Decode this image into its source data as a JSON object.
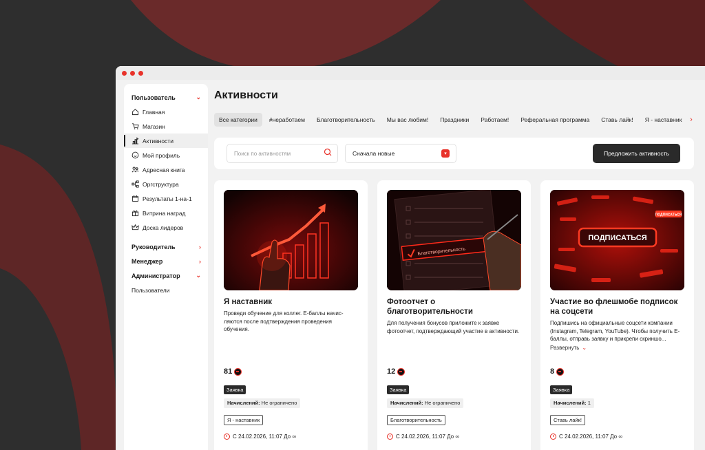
{
  "colors": {
    "accent": "#e8322a",
    "dark": "#2a2a2a",
    "background": "#2e2e2e",
    "panel": "#f2f2f2"
  },
  "window": {
    "controls": [
      "close",
      "minimize",
      "maximize"
    ]
  },
  "sidebar": {
    "user_section": "Пользователь",
    "items": [
      {
        "label": "Главная",
        "icon": "home-icon"
      },
      {
        "label": "Магазин",
        "icon": "cart-icon"
      },
      {
        "label": "Активности",
        "icon": "activity-icon",
        "active": true
      },
      {
        "label": "Мой профиль",
        "icon": "smile-icon"
      },
      {
        "label": "Адресная книга",
        "icon": "people-icon"
      },
      {
        "label": "Оргструктура",
        "icon": "org-icon"
      },
      {
        "label": "Результаты 1-на-1",
        "icon": "calendar-icon"
      },
      {
        "label": "Витрина наград",
        "icon": "gift-icon"
      },
      {
        "label": "Доска лидеров",
        "icon": "crown-icon"
      }
    ],
    "manager_section": "Руководитель",
    "menedzher_section": "Менеджер",
    "admin_section": "Администратор",
    "admin_items": [
      "Пользователи"
    ]
  },
  "main": {
    "title": "Активности",
    "tabs": [
      "Все категории",
      "#неработаем",
      "Благотворительность",
      "Мы вас любим!",
      "Праздники",
      "Работаем!",
      "Реферальная программа",
      "Ставь лайк!",
      "Я - наставник"
    ],
    "search_placeholder": "Поиск по активностям",
    "sort_value": "Сначала новые",
    "propose_button": "Предложить активность"
  },
  "cards": [
    {
      "title": "Я наставник",
      "description": "Проведи обучение для коллег. Е-баллы начис-ляются после подтверждения проведения обучения.",
      "points": "81",
      "type_badge": "Заявка",
      "limit_label": "Начислений:",
      "limit_value": "Не ограничено",
      "tag": "Я - наставник",
      "date": "С 24.02.2026, 11:07 До ∞",
      "image": "chart-growth-hand-image"
    },
    {
      "title": "Фотоотчет о благотворительности",
      "description": "Для получения бонусов приложите к заявке фотоотчет, подтверждающий участие в активности.",
      "points": "12",
      "type_badge": "Заявка",
      "limit_label": "Начислений:",
      "limit_value": "Не ограничено",
      "tag": "Благотворительность",
      "date": "С 24.02.2026, 11:07 До ∞",
      "image": "checklist-image",
      "image_label": "Благотворительность"
    },
    {
      "title": "Участие во флешмобе подписок на соцсети",
      "description": "Подпишись на официальные соцсети компании (Instagram, Telegram, YouTube). Чтобы получить Е-баллы, отправь заявку и прикрепи скриншо...",
      "expand": "Развернуть",
      "points": "8",
      "type_badge": "Заявка",
      "limit_label": "Начислений:",
      "limit_value": "1",
      "tag": "Ставь лайк!",
      "date": "С 24.02.2026, 11:07 До ∞",
      "image": "subscribe-buttons-image",
      "image_label": "ПОДПИСАТЬСЯ",
      "image_small_label": "ПОДПИСАТЬСЯ"
    }
  ]
}
